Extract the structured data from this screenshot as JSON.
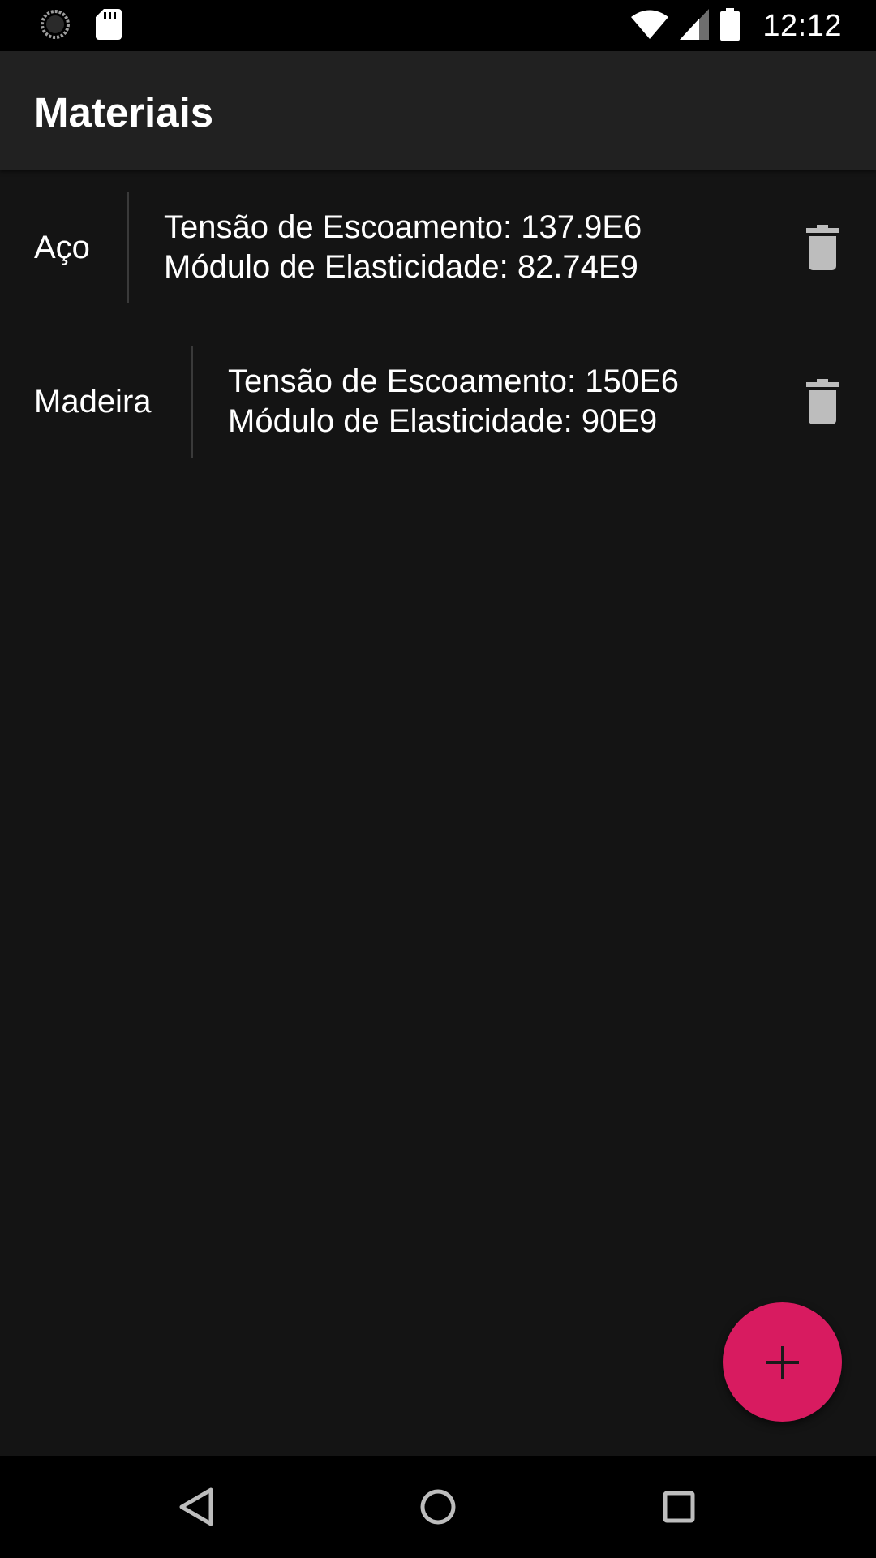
{
  "status_bar": {
    "time": "12:12",
    "icons": [
      "sync-icon",
      "sd-card-icon",
      "wifi-icon",
      "cell-signal-icon",
      "battery-icon"
    ]
  },
  "app_bar": {
    "title": "Materiais"
  },
  "materials": [
    {
      "name": "Aço",
      "yield_strength": "Tensão de Escoamento: 137.9E6",
      "elastic_modulus": "Módulo de Elasticidade: 82.74E9"
    },
    {
      "name": "Madeira",
      "yield_strength": "Tensão de Escoamento: 150E6",
      "elastic_modulus": "Módulo de Elasticidade: 90E9"
    }
  ],
  "fab": {
    "icon": "plus-icon",
    "color": "#d81b60"
  },
  "nav_bar": {
    "icons": [
      "back-icon",
      "home-icon",
      "recents-icon"
    ]
  },
  "colors": {
    "background": "#141414",
    "app_bar": "#212121",
    "accent": "#d81b60",
    "icon_gray": "#bdbdbd"
  }
}
